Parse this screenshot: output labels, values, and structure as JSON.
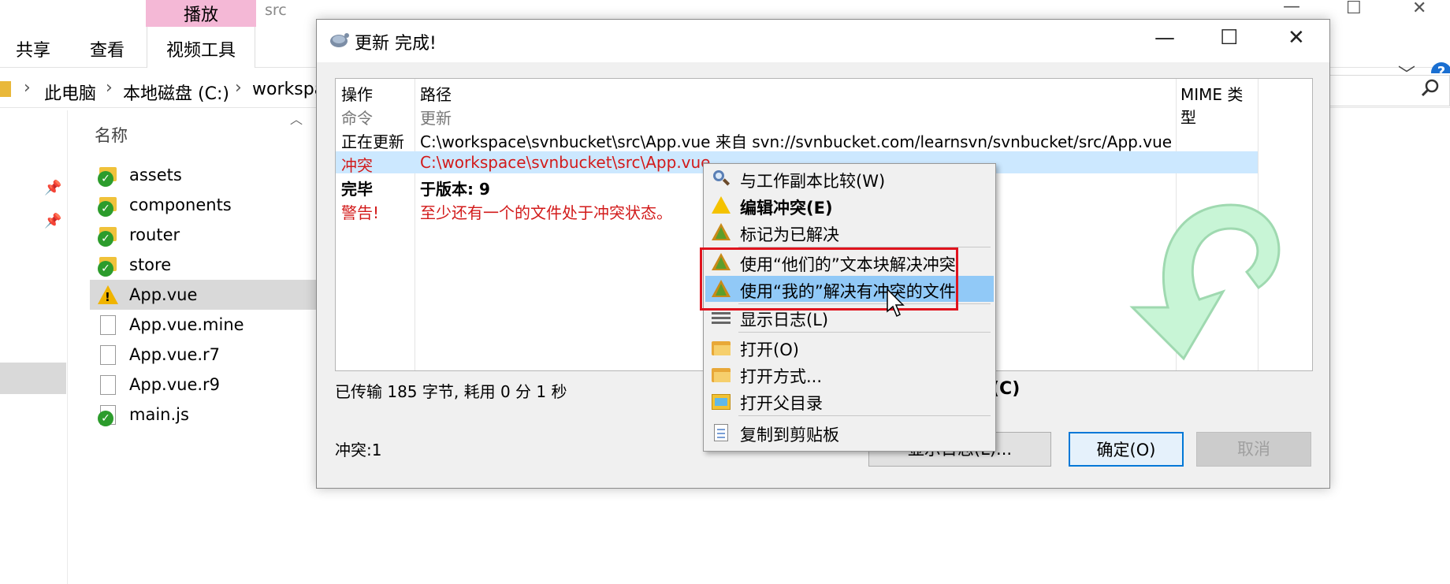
{
  "explorer": {
    "contextual_tab": "播放",
    "folder_title": "src",
    "tabs": [
      "共享",
      "查看",
      "视频工具"
    ],
    "breadcrumb": [
      "此电脑",
      "本地磁盘 (C:)",
      "workspa"
    ],
    "column_name": "名称",
    "files": [
      {
        "name": "assets",
        "icon": "svn-folder-ok-icon"
      },
      {
        "name": "components",
        "icon": "svn-folder-ok-icon"
      },
      {
        "name": "router",
        "icon": "svn-folder-ok-icon"
      },
      {
        "name": "store",
        "icon": "svn-folder-ok-icon"
      },
      {
        "name": "App.vue",
        "icon": "svn-conflict-icon"
      },
      {
        "name": "App.vue.mine",
        "icon": "file-icon"
      },
      {
        "name": "App.vue.r7",
        "icon": "file-icon"
      },
      {
        "name": "App.vue.r9",
        "icon": "file-icon"
      },
      {
        "name": "main.js",
        "icon": "svn-js-ok-icon"
      }
    ]
  },
  "dialog": {
    "title": "更新 完成!",
    "columns": {
      "action": "操作",
      "path": "路径",
      "mime": "MIME 类型"
    },
    "rows": [
      {
        "action": "命令",
        "path": "更新"
      },
      {
        "action": "正在更新",
        "path": "C:\\workspace\\svnbucket\\src\\App.vue 来自 svn://svnbucket.com/learnsvn/svnbucket/src/App.vue"
      },
      {
        "action": "冲突",
        "path": "C:\\workspace\\svnbucket\\src\\App.vue"
      },
      {
        "action": "完毕",
        "path": "于版本: 9"
      },
      {
        "action": "警告!",
        "path": "至少还有一个的文件处于冲突状态。"
      }
    ],
    "transfer_status": "已传输 185 字节, 耗用 0 分 1 秒",
    "abort_fragment": "(C)",
    "conflict_count": "冲突:1",
    "buttons": {
      "show_log": "显示日志(L)...",
      "ok": "确定(O)",
      "cancel": "取消"
    }
  },
  "context_menu": {
    "items": [
      {
        "label": "与工作副本比较(W)",
        "icon": "compare-magnifier-icon"
      },
      {
        "label": "编辑冲突(E)",
        "icon": "edit-conflict-icon"
      },
      {
        "label": "标记为已解决",
        "icon": "resolved-icon"
      },
      {
        "label": "使用“他们的”文本块解决冲突",
        "icon": "resolve-theirs-icon"
      },
      {
        "label": "使用“我的”解决有冲突的文件",
        "icon": "resolve-mine-icon"
      },
      {
        "label": "显示日志(L)",
        "icon": "show-log-icon"
      },
      {
        "label": "打开(O)",
        "icon": "open-folder-icon"
      },
      {
        "label": "打开方式...",
        "icon": "open-with-icon"
      },
      {
        "label": "打开父目录",
        "icon": "parent-folder-icon"
      },
      {
        "label": "复制到剪贴板",
        "icon": "clipboard-icon"
      }
    ],
    "selected_index": 4
  },
  "colors": {
    "accent_blue": "#0078d7",
    "selection": "#cce8ff",
    "menu_hover": "#91c9f7",
    "conflict_red": "#d21a1a",
    "highlight_box": "#e0141e",
    "ribbon_pink": "#f4b8d6"
  }
}
